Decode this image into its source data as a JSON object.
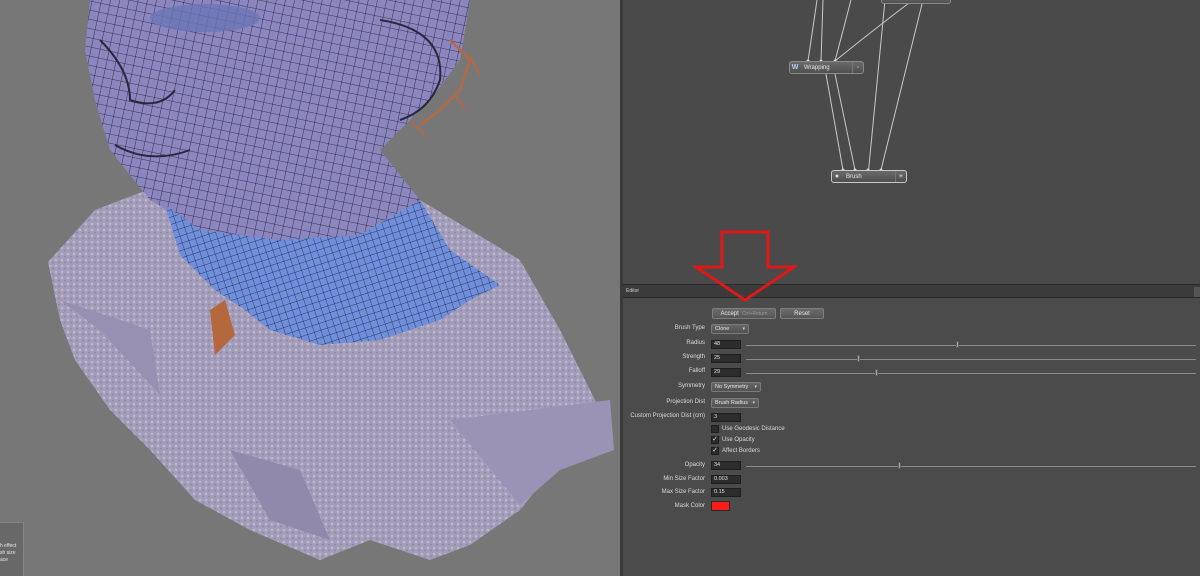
{
  "viewport": {
    "hud_lines": [
      "h effect",
      "sh size",
      "ace"
    ]
  },
  "nodes": {
    "wrapping": {
      "label": "Wrapping",
      "icon": "W"
    },
    "brush": {
      "label": "Brush"
    }
  },
  "editor": {
    "title": "Editor",
    "accept_label": "Accept",
    "accept_hint": "Ctrl+Return",
    "reset_label": "Reset",
    "brush_type": {
      "label": "Brush Type",
      "value": "Clone"
    },
    "radius": {
      "label": "Radius",
      "value": "48",
      "fraction": 0.47
    },
    "strength": {
      "label": "Strength",
      "value": "25",
      "fraction": 0.25
    },
    "falloff": {
      "label": "Falloff",
      "value": "29",
      "fraction": 0.29
    },
    "symmetry": {
      "label": "Symmetry",
      "value": "No Symmetry"
    },
    "projection_dist": {
      "label": "Projection Dist",
      "value": "Brush Radius"
    },
    "custom_projection": {
      "label": "Custom Projection Dist (cm)",
      "value": "3"
    },
    "use_geodesic": {
      "label": "Use Geodesic Distance",
      "checked": false
    },
    "use_opacity": {
      "label": "Use Opacity",
      "checked": true
    },
    "affect_borders": {
      "label": "Affect Borders",
      "checked": true
    },
    "opacity": {
      "label": "Opacity",
      "value": "34",
      "fraction": 0.34
    },
    "min_size": {
      "label": "Min Size Factor",
      "value": "0.003"
    },
    "max_size": {
      "label": "Max Size Factor",
      "value": "0.15"
    },
    "mask_color": {
      "label": "Mask Color",
      "color": "#ff1a1a"
    }
  },
  "colors": {
    "annotation_arrow": "#e01818",
    "mesh_wire": "#1a1a2e",
    "skin_purple": "#8c86bf",
    "selection_blue": "#6f8fdc"
  }
}
